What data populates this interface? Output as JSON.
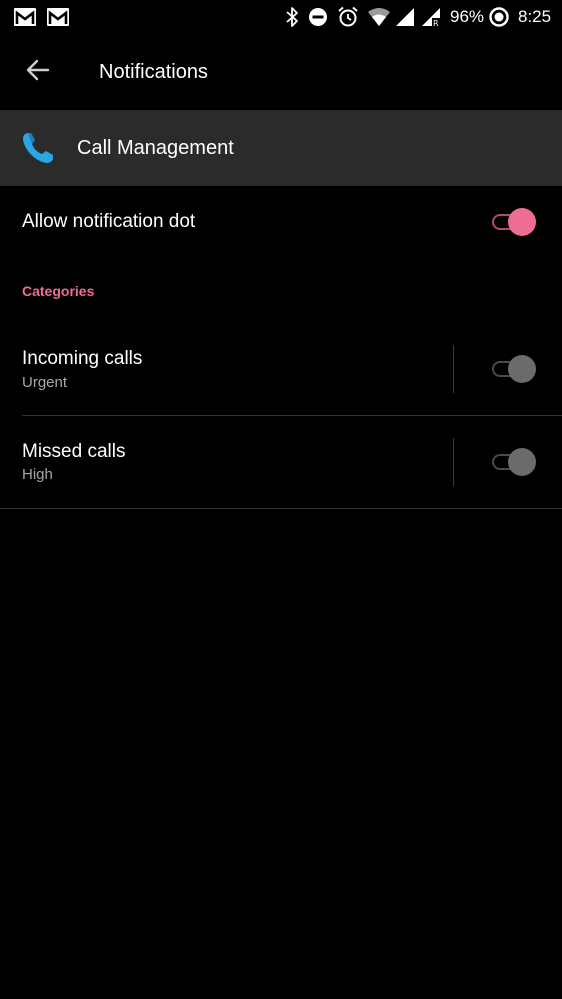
{
  "status_bar": {
    "battery": "96%",
    "time": "8:25",
    "left_icons": [
      "gmail-icon",
      "gmail-icon"
    ],
    "right_icons": [
      "bluetooth-icon",
      "do-not-disturb-icon",
      "alarm-icon",
      "wifi-icon",
      "signal-icon",
      "signal-roaming-icon",
      "battery-saver-icon"
    ]
  },
  "app_bar": {
    "title": "Notifications"
  },
  "app_header": {
    "name": "Call Management",
    "icon": "phone-icon"
  },
  "notification_dot": {
    "label": "Allow notification dot",
    "enabled": true
  },
  "categories": {
    "header": "Categories",
    "items": [
      {
        "title": "Incoming calls",
        "importance": "Urgent",
        "enabled": false
      },
      {
        "title": "Missed calls",
        "importance": "High",
        "enabled": false
      }
    ]
  },
  "colors": {
    "accent": "#ee6d92",
    "accent_track": "#b34c66",
    "background": "#000000",
    "header_bg": "#2b2b2b",
    "subtitle": "#a8a8a8",
    "toggle_off_thumb": "#6b6b6b"
  }
}
